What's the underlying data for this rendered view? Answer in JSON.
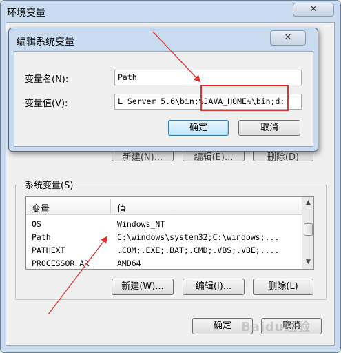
{
  "outer_dialog": {
    "title": "环境变量",
    "close_label": "✕",
    "user_buttons": {
      "new_label": "新建(N)...",
      "edit_label": "编辑(E)...",
      "delete_label": "删除(D)"
    },
    "system_group_label": "系统变量(S)",
    "columns": [
      "变量",
      "值"
    ],
    "rows": [
      {
        "variable": "OS",
        "value": "Windows_NT"
      },
      {
        "variable": "Path",
        "value": "C:\\windows\\system32;C:\\windows;..."
      },
      {
        "variable": "PATHEXT",
        "value": ".COM;.EXE;.BAT;.CMD;.VBS;.VBE;...."
      },
      {
        "variable": "PROCESSOR_AR",
        "value": "AMD64"
      }
    ],
    "system_buttons": {
      "new_label": "新建(W)...",
      "edit_label": "编辑(I)...",
      "delete_label": "删除(L)"
    },
    "ok_label": "确定",
    "cancel_label": "取消"
  },
  "edit_dialog": {
    "title": "编辑系统变量",
    "close_label": "✕",
    "name_label": "变量名(N):",
    "name_value": "Path",
    "value_label": "变量值(V):",
    "value_value": "L Server 5.6\\bin;%JAVA_HOME%\\bin;d:",
    "ok_label": "确定",
    "cancel_label": "取消"
  },
  "annotation_color": "#e03030",
  "watermark": "Baidu经验"
}
